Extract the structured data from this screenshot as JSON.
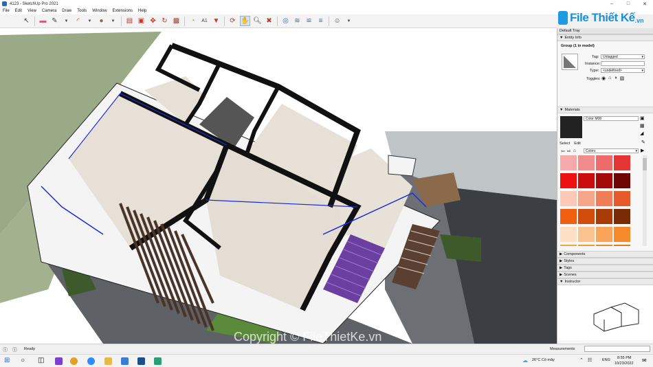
{
  "window": {
    "title": "4123 - SketchUp Pro 2021"
  },
  "menu": [
    "File",
    "Edit",
    "View",
    "Camera",
    "Draw",
    "Tools",
    "Window",
    "Extensions",
    "Help"
  ],
  "watermark": {
    "logo_text": "File Thiết Kế",
    "logo_suffix": ".vn",
    "copyright": "Copyright © FileThietKe.vn"
  },
  "tray": {
    "title": "Default Tray",
    "entity_info": {
      "header": "Entity Info",
      "group_label": "Group (1 in model)",
      "tag_label": "Tag:",
      "tag_value": "Untagged",
      "instance_label": "Instance:",
      "instance_value": "",
      "type_label": "Type:",
      "type_value": "<undefined>",
      "toggles_label": "Toggles:"
    },
    "materials": {
      "header": "Materials",
      "current_name": "Color M08",
      "current_color": "#222222",
      "tab_select": "Select",
      "tab_edit": "Edit",
      "library": "Colors",
      "swatches": [
        "#f5a9a9",
        "#f08c8c",
        "#ee6b6b",
        "#e53434",
        "#ee1111",
        "#cc0d0d",
        "#a30a0a",
        "#6e0505",
        "#fbc9b6",
        "#f5a689",
        "#f07d56",
        "#e55a2b",
        "#f06010",
        "#d24d0b",
        "#a83c08",
        "#7a2b05",
        "#fde0c4",
        "#fbc48f",
        "#f8a55a",
        "#f48a2a",
        "#f7a43a",
        "#f59a2a",
        "#ee8a1a",
        "#e07c10"
      ]
    },
    "collapsed_panels": [
      "Components",
      "Styles",
      "Tags",
      "Scenes"
    ],
    "instructor": "Instructor"
  },
  "status": {
    "text": "Ready",
    "measurements_label": "Measurements"
  },
  "taskbar": {
    "weather": "26°C  Có mây",
    "lang": "ENG",
    "time": "8:55 PM",
    "date": "10/23/2022"
  }
}
